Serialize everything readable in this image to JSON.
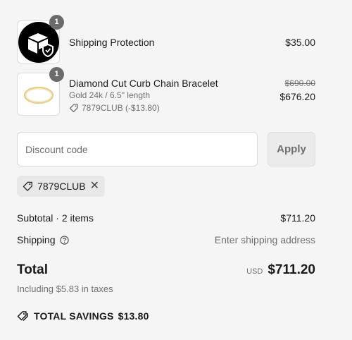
{
  "items": [
    {
      "name": "Shipping Protection",
      "quantity": "1",
      "price": "$35.00",
      "image_icon": "package-shield-icon"
    },
    {
      "name": "Diamond Cut Curb Chain Bracelet",
      "quantity": "1",
      "variant": "Gold 24k / 6.5\" length",
      "discount": "7879CLUB (-$13.80)",
      "original_price": "$690.00",
      "price": "$676.20",
      "image_icon": "bracelet-icon"
    }
  ],
  "discount": {
    "placeholder": "Discount code",
    "apply_label": "Apply",
    "applied_code": "7879CLUB"
  },
  "summary": {
    "subtotal_label": "Subtotal · 2 items",
    "subtotal_value": "$711.20",
    "shipping_label": "Shipping",
    "shipping_value": "Enter shipping address",
    "total_label": "Total",
    "currency": "USD",
    "total_value": "$711.20",
    "taxes_note": "Including $5.83 in taxes",
    "savings_label": "TOTAL SAVINGS",
    "savings_value": "$13.80"
  },
  "colors": {
    "background": "#f5f5f5",
    "text": "#1a1a1a",
    "muted": "#707070",
    "badge": "#6b6b6b"
  }
}
